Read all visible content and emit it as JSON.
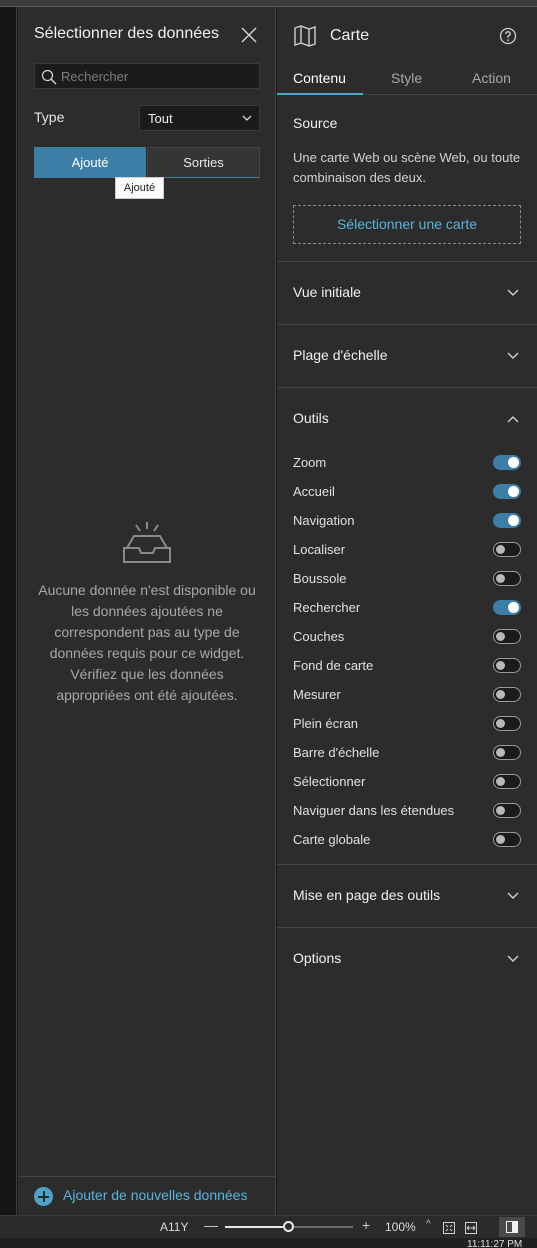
{
  "left_panel": {
    "title": "Sélectionner des données",
    "search_placeholder": "Rechercher",
    "type_label": "Type",
    "type_value": "Tout",
    "segments": {
      "added": "Ajouté",
      "outputs": "Sorties"
    },
    "tooltip": "Ajouté",
    "empty_message": "Aucune donnée n'est disponible ou les données ajoutées ne correspondent pas au type de données requis pour ce widget. Vérifiez que les données appropriées ont été ajoutées.",
    "add_data_label": "Ajouter de nouvelles données"
  },
  "right_panel": {
    "title": "Carte",
    "tabs": [
      "Contenu",
      "Style",
      "Action"
    ],
    "active_tab": "Contenu",
    "source": {
      "title": "Source",
      "description": "Une carte Web ou scène Web, ou toute combinaison des deux.",
      "select_button": "Sélectionner une carte"
    },
    "sections": {
      "initial_view": "Vue initiale",
      "scale_range": "Plage d'échelle",
      "tools": "Outils",
      "tools_layout": "Mise en page des outils",
      "options": "Options"
    },
    "tools": [
      {
        "label": "Zoom",
        "enabled": true
      },
      {
        "label": "Accueil",
        "enabled": true
      },
      {
        "label": "Navigation",
        "enabled": true
      },
      {
        "label": "Localiser",
        "enabled": false
      },
      {
        "label": "Boussole",
        "enabled": false
      },
      {
        "label": "Rechercher",
        "enabled": true
      },
      {
        "label": "Couches",
        "enabled": false
      },
      {
        "label": "Fond de carte",
        "enabled": false
      },
      {
        "label": "Mesurer",
        "enabled": false
      },
      {
        "label": "Plein écran",
        "enabled": false
      },
      {
        "label": "Barre d'échelle",
        "enabled": false
      },
      {
        "label": "Sélectionner",
        "enabled": false
      },
      {
        "label": "Naviguer dans les étendues",
        "enabled": false
      },
      {
        "label": "Carte globale",
        "enabled": false
      }
    ]
  },
  "status_bar": {
    "cell_ref": "A11Y",
    "zoom_percent": "100%",
    "zoom_level": 0.5,
    "clock": "11:11:27 PM"
  },
  "colors": {
    "accent": "#3d7ea6",
    "link": "#5ab4dc",
    "panel": "#2c2c2c"
  }
}
